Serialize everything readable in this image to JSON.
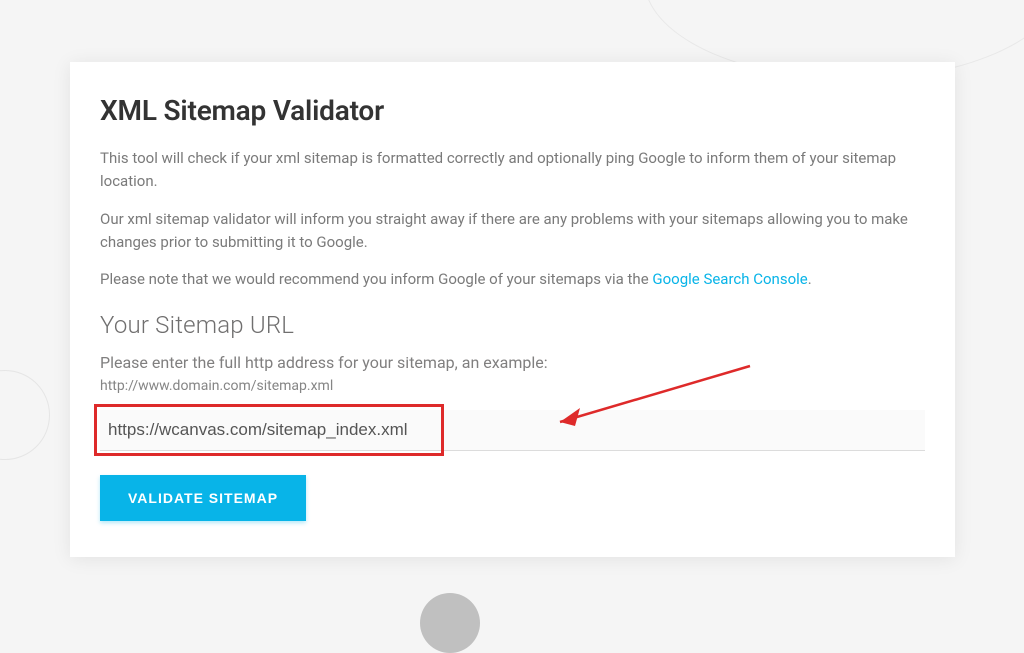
{
  "page": {
    "title": "XML Sitemap Validator",
    "desc1": "This tool will check if your xml sitemap is formatted correctly and optionally ping Google to inform them of your sitemap location.",
    "desc2": "Our xml sitemap validator will inform you straight away if there are any problems with your sitemaps allowing you to make changes prior to submitting it to Google.",
    "desc3_prefix": "Please note that we would recommend you inform Google of your sitemaps via the ",
    "desc3_link": "Google Search Console",
    "desc3_suffix": "."
  },
  "form": {
    "section_title": "Your Sitemap URL",
    "hint": "Please enter the full http address for your sitemap, an example:",
    "example": "http://www.domain.com/sitemap.xml",
    "input_value": "https://wcanvas.com/sitemap_index.xml",
    "button_label": "VALIDATE SITEMAP"
  }
}
